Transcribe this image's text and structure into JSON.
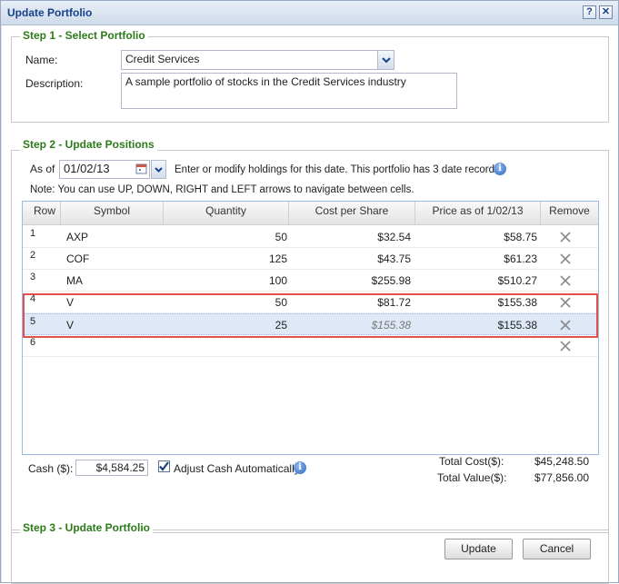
{
  "window": {
    "title": "Update Portfolio",
    "help_icon": "question-icon",
    "close_icon": "close-icon"
  },
  "step1": {
    "legend": "Step 1 - Select Portfolio",
    "name_label": "Name:",
    "name_value": "Credit Services",
    "description_label": "Description:",
    "description_value": "A sample portfolio of stocks in the Credit Services industry"
  },
  "step2": {
    "legend": "Step 2 - Update Positions",
    "as_of_label": "As of",
    "date_value": "01/02/13",
    "info_text": "Enter or modify holdings for this date. This portfolio has 3 date records",
    "note": "Note: You can use UP, DOWN, RIGHT and LEFT arrows to navigate between cells.",
    "columns": [
      "Row",
      "Symbol",
      "Quantity",
      "Cost per Share",
      "Price as of 1/02/13",
      "Remove"
    ],
    "rows": [
      {
        "row": "1",
        "symbol": "AXP",
        "quantity": "50",
        "cost": "$32.54",
        "price": "$58.75"
      },
      {
        "row": "2",
        "symbol": "COF",
        "quantity": "125",
        "cost": "$43.75",
        "price": "$61.23"
      },
      {
        "row": "3",
        "symbol": "MA",
        "quantity": "100",
        "cost": "$255.98",
        "price": "$510.27"
      },
      {
        "row": "4",
        "symbol": "V",
        "quantity": "50",
        "cost": "$81.72",
        "price": "$155.38"
      },
      {
        "row": "5",
        "symbol": "V",
        "quantity": "25",
        "cost": "$155.38",
        "price": "$155.38"
      },
      {
        "row": "6",
        "symbol": "",
        "quantity": "",
        "cost": "",
        "price": ""
      }
    ],
    "cash_label": "Cash ($):",
    "cash_value": "$4,584.25",
    "adjust_cash_label": "Adjust Cash Automatically",
    "adjust_cash_checked": true,
    "total_cost_label": "Total Cost($):",
    "total_cost_value": "$45,248.50",
    "total_value_label": "Total Value($):",
    "total_value_value": "$77,856.00"
  },
  "step3": {
    "legend": "Step 3 - Update Portfolio",
    "update_label": "Update",
    "cancel_label": "Cancel"
  },
  "colors": {
    "legend_green": "#2c7a1a",
    "title_blue": "#15428b",
    "highlight_red": "#e4514b",
    "selected_row": "#dfe8f6"
  }
}
